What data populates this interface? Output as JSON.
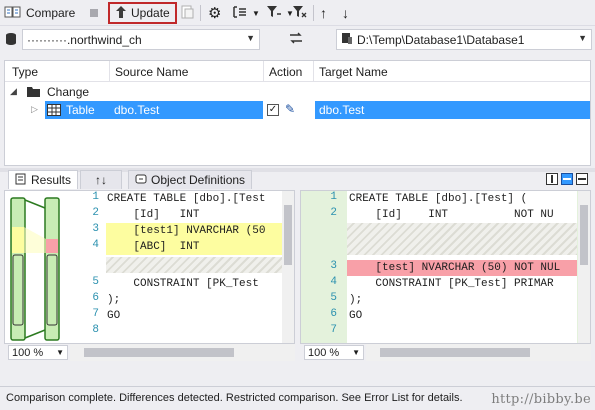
{
  "toolbar": {
    "compare_label": "Compare",
    "update_label": "Update"
  },
  "connection": {
    "source_db": "··········.northwind_ch",
    "target_db": "D:\\Temp\\Database1\\Database1"
  },
  "grid": {
    "headers": [
      "Type",
      "Source Name",
      "Action",
      "Target Name"
    ],
    "group_label": "Change",
    "row": {
      "type": "Table",
      "source": "dbo.Test",
      "target": "dbo.Test",
      "checked": true
    }
  },
  "tabs": {
    "results": "Results",
    "sort": "↑↓",
    "object_definitions": "Object Definitions"
  },
  "left_code": [
    {
      "n": "1",
      "text": "CREATE TABLE [dbo].[Test"
    },
    {
      "n": "2",
      "text": "    [Id]   INT"
    },
    {
      "n": "3",
      "text": "    [test1] NVARCHAR (50"
    },
    {
      "n": "4",
      "text": "    [ABC]  INT"
    },
    {
      "n": "5",
      "text": "    CONSTRAINT [PK_Test"
    },
    {
      "n": "6",
      "text": ");"
    },
    {
      "n": "7",
      "text": "GO"
    },
    {
      "n": "8",
      "text": ""
    }
  ],
  "right_code": [
    {
      "n": "1",
      "text": "CREATE TABLE [dbo].[Test] ("
    },
    {
      "n": "2",
      "text": "    [Id]    INT          NOT NU"
    },
    {
      "n": "3",
      "text": "    [test] NVARCHAR (50) NOT NUL"
    },
    {
      "n": "4",
      "text": "    CONSTRAINT [PK_Test] PRIMAR"
    },
    {
      "n": "5",
      "text": ");"
    },
    {
      "n": "6",
      "text": "GO"
    },
    {
      "n": "7",
      "text": ""
    }
  ],
  "zoom_left": "100 %",
  "zoom_right": "100 %",
  "status": "Comparison complete.  Differences detected. Restricted comparison. See Error List for details.",
  "watermark": "http://bibby.be",
  "colors": {
    "accent": "#3399ff",
    "added": "#fdfda0",
    "removed": "#f8a0a8",
    "minimap": "#c8ecb4",
    "update_border": "#c0282a"
  }
}
